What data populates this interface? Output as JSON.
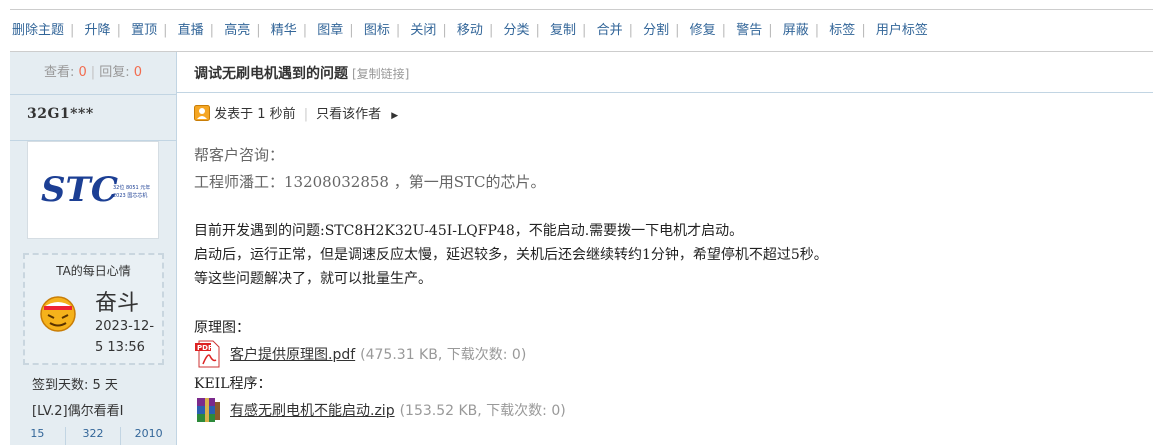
{
  "toolbar": {
    "items": [
      "删除主题",
      "升降",
      "置顶",
      "直播",
      "高亮",
      "精华",
      "图章",
      "图标",
      "关闭",
      "移动",
      "分类",
      "复制",
      "合并",
      "分割",
      "修复",
      "警告",
      "屏蔽",
      "标签",
      "用户标签"
    ]
  },
  "sidebar": {
    "views_label": "查看:",
    "views": "0",
    "replies_label": "回复:",
    "replies": "0",
    "username": "32G1***",
    "avatar_text": "STC",
    "avatar_sub1": "32位 8051 元年",
    "avatar_sub2": "2023 国芯芯机",
    "mood_title": "TA的每日心情",
    "mood_word": "奋斗",
    "mood_date_line1": "2023-12-",
    "mood_date_line2": "5 13:56",
    "checkin": "签到天数: 5 天",
    "level": "[LV.2]偶尔看看I",
    "stats": [
      "15",
      "322",
      "2010"
    ]
  },
  "thread": {
    "title": "调试无刷电机遇到的问题",
    "copy_link": "[复制链接]",
    "posted": "发表于 1 秒前",
    "only_author": "只看该作者"
  },
  "post": {
    "lines_grey": [
      "帮客户咨询：",
      "工程师潘工：13208032858 ，第一用STC的芯片。"
    ],
    "lines_dark": [
      "目前开发遇到的问题:STC8H2K32U-45I-LQFP48，不能启动.需要拨一下电机才启动。",
      "启动后，运行正常，但是调速反应太慢，延迟较多，关机后还会继续转约1分钟，希望停机不超过5秒。",
      "等这些问题解决了，就可以批量生产。"
    ],
    "schematic_label": "原理图：",
    "attachment1_name": "客户提供原理图.pdf",
    "attachment1_meta": "(475.31 KB, 下载次数: 0)",
    "keil_label": "KEIL程序：",
    "attachment2_name": "有感无刷电机不能启动.zip",
    "attachment2_meta": "(153.52 KB, 下载次数: 0)"
  },
  "colors": {
    "link": "#336699",
    "accent": "#f26c4f",
    "sidebar_bg": "#e5edf2"
  }
}
